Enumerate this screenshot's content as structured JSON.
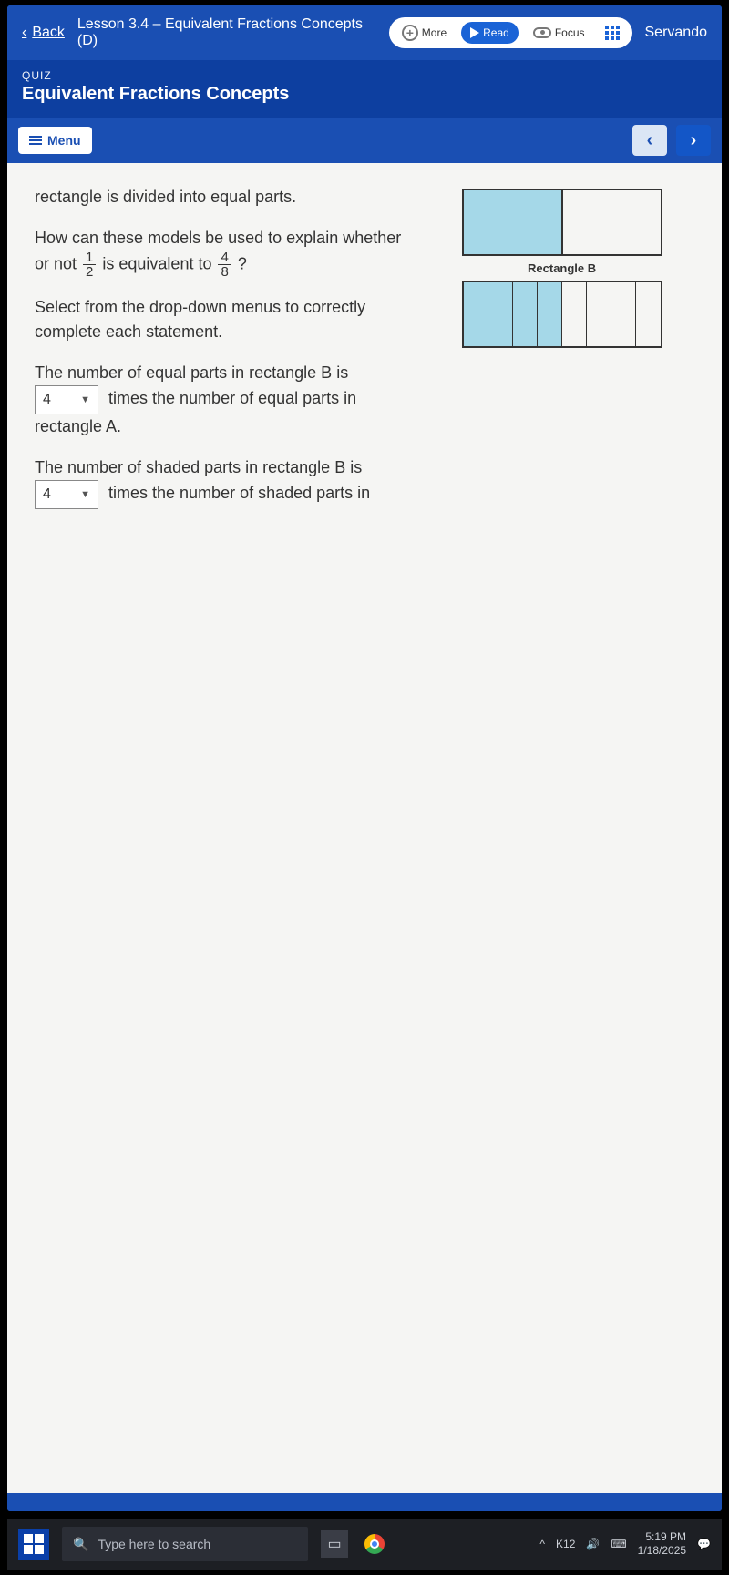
{
  "topbar": {
    "back_label": "Back",
    "lesson_title": "Lesson 3.4 – Equivalent Fractions Concepts (D)",
    "user_name": "Servando",
    "more_label": "More",
    "read_label": "Read",
    "focus_label": "Focus"
  },
  "subhead": {
    "quiz_label": "QUIZ",
    "quiz_title": "Equivalent Fractions Concepts"
  },
  "menu": {
    "menu_label": "Menu"
  },
  "question": {
    "line1": "rectangle is divided into equal parts.",
    "line2_a": "How can these models be used to explain whether or not ",
    "line2_b": " is equivalent to ",
    "line2_c": "?",
    "frac1_n": "1",
    "frac1_d": "2",
    "frac2_n": "4",
    "frac2_d": "8",
    "instruct": "Select from the drop-down menus to correctly complete each statement.",
    "stmt1_a": "The number of equal parts in rectangle B is",
    "stmt1_b": " times the number of equal parts in rectangle A.",
    "stmt2_a": "The number of shaded parts in rectangle B is",
    "stmt2_b": " times the number of shaded parts in",
    "dd1_value": "4",
    "dd2_value": "4"
  },
  "diagram": {
    "label_b": "Rectangle B"
  },
  "taskbar": {
    "search_placeholder": "Type here to search",
    "tray_net": "K12",
    "time": "5:19 PM",
    "date": "1/18/2025"
  }
}
